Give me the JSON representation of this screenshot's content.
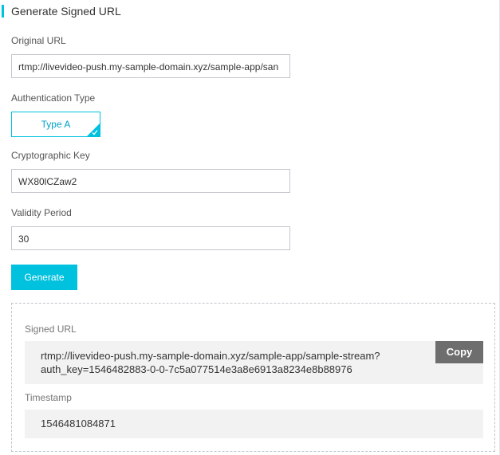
{
  "header": {
    "title": "Generate Signed URL"
  },
  "form": {
    "original_url": {
      "label": "Original URL",
      "value": "rtmp://livevideo-push.my-sample-domain.xyz/sample-app/san"
    },
    "auth_type": {
      "label": "Authentication Type",
      "selected": "Type A"
    },
    "crypto_key": {
      "label": "Cryptographic Key",
      "value": "WX80lCZaw2"
    },
    "validity": {
      "label": "Validity Period",
      "value": "30"
    },
    "generate_label": "Generate"
  },
  "result": {
    "signed_url": {
      "label": "Signed URL",
      "line1": "rtmp://livevideo-push.my-sample-domain.xyz/sample-app/sample-stream?",
      "line2": "auth_key=1546482883-0-0-7c5a077514e3a8e6913a8234e8b88976"
    },
    "copy_label": "Copy",
    "timestamp": {
      "label": "Timestamp",
      "value": "1546481084871"
    }
  },
  "colors": {
    "accent": "#00c1de",
    "copy_button": "#6e6e6e",
    "field_bg": "#f2f2f2"
  },
  "icons": {
    "selected_check": "check-icon"
  }
}
